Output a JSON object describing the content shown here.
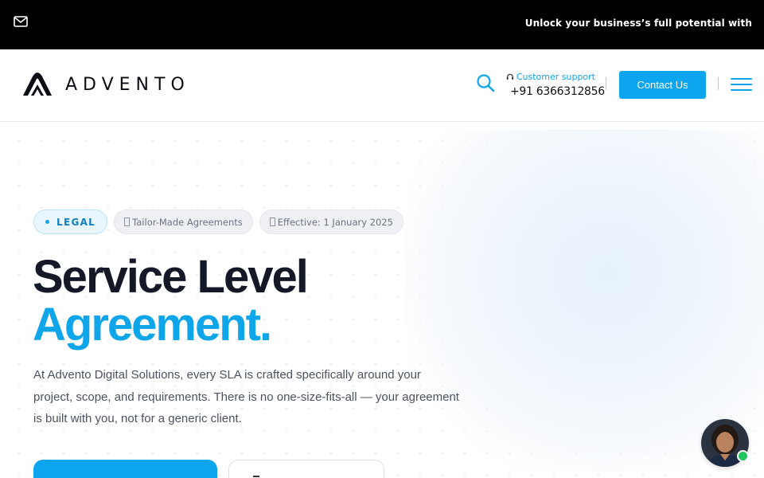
{
  "topbar": {
    "promo_text": "Unlock your business’s full potential with",
    "mail_icon": "mail-icon"
  },
  "header": {
    "logo_text": "ADVENTO",
    "support_label": "Customer support",
    "support_phone": "+91 6366312856",
    "contact_button": "Contact Us",
    "icons": [
      "search-icon",
      "headset-icon",
      "menu-icon"
    ]
  },
  "hero": {
    "badges": [
      "LEGAL",
      "Tailor-Made Agreements",
      "Effective: 1 January 2025"
    ],
    "title_line1": "Service Level",
    "title_line2": "Agreement.",
    "description": "At Advento Digital Solutions, every SLA is crafted specifically around your project, scope, and requirements. There is no one-size-fits-all — your agreement is built with you, not for a generic client."
  },
  "colors": {
    "accent": "#0ea5e9",
    "topbar_bg": "#000000",
    "title_dark": "#151827",
    "online": "#22c55e"
  }
}
